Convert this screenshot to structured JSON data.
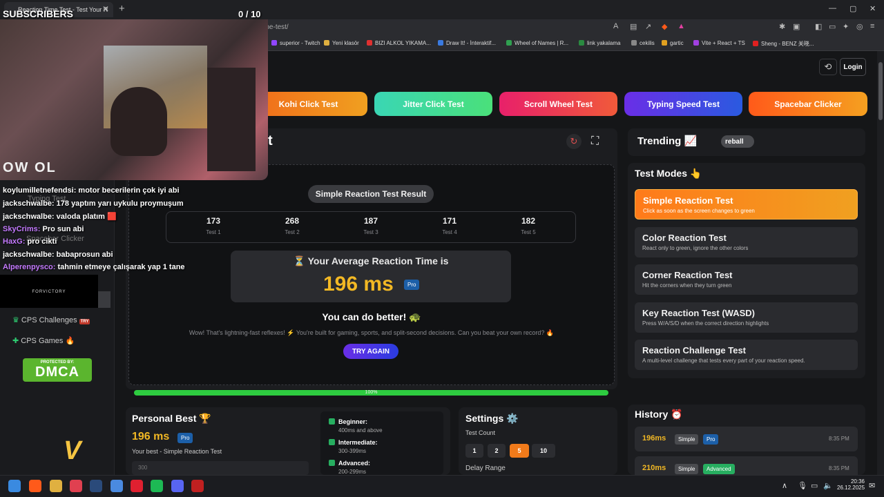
{
  "browser": {
    "tab_title": "Reaction Time Test - Test Your R",
    "url": "cpstest.org/reaction-time-test/",
    "bookmarks": [
      {
        "label": "superior - Twitch",
        "color": "#9146ff"
      },
      {
        "label": "Yeni klasör",
        "color": "#e0b040"
      },
      {
        "label": "BIZI ALKOL YIKAMA...",
        "color": "#e03030"
      },
      {
        "label": "Draw It! - İnteraktif...",
        "color": "#3a7ae0"
      },
      {
        "label": "Wheel of Names | R...",
        "color": "#30a050"
      },
      {
        "label": "link yakalama",
        "color": "#2a8a40"
      },
      {
        "label": "cekilis",
        "color": "#888888"
      },
      {
        "label": "gartic",
        "color": "#e0a020"
      },
      {
        "label": "Vite + React + TS",
        "color": "#a040e0"
      },
      {
        "label": "Sheng - BENZ 关晓...",
        "color": "#e02020"
      }
    ]
  },
  "header": {
    "login": "Login"
  },
  "test_buttons": [
    {
      "label": "Kohi Click Test",
      "color1": "#f06a1a",
      "color2": "#f0a020"
    },
    {
      "label": "Jitter Click Test",
      "color1": "#3ad6b4",
      "color2": "#4ae07a"
    },
    {
      "label": "Scroll Wheel Test",
      "color1": "#e8206a",
      "color2": "#f05a3a"
    },
    {
      "label": "Typing Speed Test",
      "color1": "#6a2ee6",
      "color2": "#2a5ae0"
    },
    {
      "label": "Spacebar Clicker",
      "color1": "#ff5a1a",
      "color2": "#f5a020"
    }
  ],
  "main": {
    "title_fragment": "t",
    "result_label": "Simple Reaction Test Result",
    "trials": [
      {
        "value": "173",
        "label": "Test 1"
      },
      {
        "value": "268",
        "label": "Test 2"
      },
      {
        "value": "187",
        "label": "Test 3"
      },
      {
        "value": "171",
        "label": "Test 4"
      },
      {
        "value": "182",
        "label": "Test 5"
      }
    ],
    "avg_label": "⏳ Your Average Reaction Time is",
    "avg_value": "196 ms",
    "pro_badge": "Pro",
    "feedback": "You can do better! 🐢",
    "description": "Wow! That's lightning-fast reflexes! ⚡ You're built for gaming, sports, and split-second decisions. Can you beat your own record? 🔥",
    "try_again": "TRY AGAIN",
    "progress_label": "100%",
    "progress": 1.0
  },
  "personal_best": {
    "title": "Personal Best 🏆",
    "value": "196 ms",
    "badge": "Pro",
    "subtitle": "Your best - Simple Reaction Test",
    "chart_tick": "300",
    "levels": [
      {
        "name": "Beginner:",
        "range": "400ms and above"
      },
      {
        "name": "Intermediate:",
        "range": "300-399ms"
      },
      {
        "name": "Advanced:",
        "range": "200-299ms"
      }
    ]
  },
  "settings": {
    "title": "Settings ⚙️",
    "test_count_label": "Test Count",
    "counts": [
      "1",
      "2",
      "5",
      "10"
    ],
    "selected_count": "5",
    "delay_label": "Delay Range"
  },
  "trending": {
    "title": "Trending 📈",
    "pill": "reball"
  },
  "test_modes": {
    "title": "Test Modes 👆",
    "modes": [
      {
        "title": "Simple Reaction Test",
        "desc": "Click as soon as the screen changes to green",
        "active": true
      },
      {
        "title": "Color Reaction Test",
        "desc": "React only to green, ignore the other colors",
        "active": false
      },
      {
        "title": "Corner Reaction Test",
        "desc": "Hit the corners when they turn green",
        "active": false
      },
      {
        "title": "Key Reaction Test (WASD)",
        "desc": "Press W/A/S/D when the correct direction highlights",
        "active": false
      },
      {
        "title": "Reaction Challenge Test",
        "desc": "A multi-level challenge that tests every part of your reaction speed.",
        "active": false
      }
    ]
  },
  "history": {
    "title": "History ⏰",
    "items": [
      {
        "value": "196ms",
        "mode": "Simple",
        "level": "Pro",
        "level_color": "#1c5fa8",
        "time": "8:35 PM"
      },
      {
        "value": "210ms",
        "mode": "Simple",
        "level": "Advanced",
        "level_color": "#27ae60",
        "time": "8:35 PM"
      }
    ]
  },
  "sidebar": {
    "items": [
      "Typing Test",
      "Spacebar Clicker",
      "CPS Challenges",
      "CPS Games 🔥"
    ],
    "dmca_top": "PROTECTED BY:",
    "dmca_main": "DMCA"
  },
  "stream": {
    "subs_label": "SUBSCRIBERS",
    "subs_count": "0 / 10",
    "logo": "OW OL",
    "sponsor": "FORVICTORY",
    "chat": [
      {
        "user": "koylumilletnefendsi:",
        "msg": "motor becerilerin çok iyi abi",
        "color": "#ffffff"
      },
      {
        "user": "jackschwalbe:",
        "msg": "178 yaptım yarı uykulu proymuşum",
        "color": "#ffffff"
      },
      {
        "user": "jackschwalbe:",
        "msg": "valoda platım 🟥",
        "color": "#ffffff"
      },
      {
        "user": "SkyCrims:",
        "msg": "Pro sun abi",
        "color": "#c47aff"
      },
      {
        "user": "HaxG:",
        "msg": "pro cikti",
        "color": "#c47aff"
      },
      {
        "user": "jackschwalbe:",
        "msg": "babaprosun abi",
        "color": "#ffffff"
      },
      {
        "user": "Alperenpysco:",
        "msg": "tahmin etmeye çalışarak yap 1 tane",
        "color": "#c47aff"
      }
    ]
  },
  "taskbar": {
    "time": "20:36",
    "date": "26.12.2025"
  }
}
